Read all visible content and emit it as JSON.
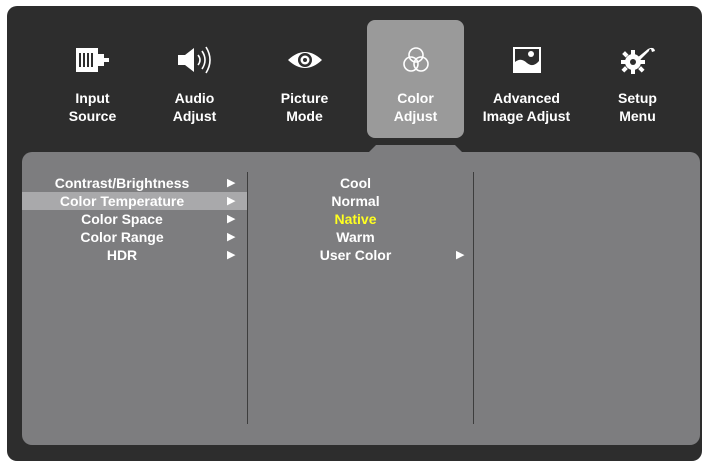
{
  "tabs": [
    {
      "line1": "Input",
      "line2": "Source",
      "icon": "input-source-icon"
    },
    {
      "line1": "Audio",
      "line2": "Adjust",
      "icon": "speaker-icon"
    },
    {
      "line1": "Picture",
      "line2": "Mode",
      "icon": "eye-icon"
    },
    {
      "line1": "Color",
      "line2": "Adjust",
      "icon": "color-circles-icon"
    },
    {
      "line1": "Advanced",
      "line2": "Image Adjust",
      "icon": "landscape-image-icon"
    },
    {
      "line1": "Setup",
      "line2": "Menu",
      "icon": "gear-wrench-icon"
    }
  ],
  "active_tab": "Color Adjust",
  "submenu": [
    {
      "label": "Contrast/Brightness",
      "arrow": "▶"
    },
    {
      "label": "Color Temperature",
      "arrow": "▶"
    },
    {
      "label": "Color Space",
      "arrow": "▶"
    },
    {
      "label": "Color Range",
      "arrow": "▶"
    },
    {
      "label": "HDR",
      "arrow": "▶"
    }
  ],
  "selected_submenu": "Color Temperature",
  "options": [
    {
      "label": "Cool",
      "arrow": ""
    },
    {
      "label": "Normal",
      "arrow": ""
    },
    {
      "label": "Native",
      "arrow": ""
    },
    {
      "label": "Warm",
      "arrow": ""
    },
    {
      "label": "User Color",
      "arrow": "▶"
    }
  ],
  "current_option": "Native",
  "colors": {
    "frame": "#2d2d2d",
    "panel": "#7d7d7f",
    "highlight": "#a9a9ab",
    "active_tab": "#9a9a9a",
    "current_value": "#ffff20"
  }
}
